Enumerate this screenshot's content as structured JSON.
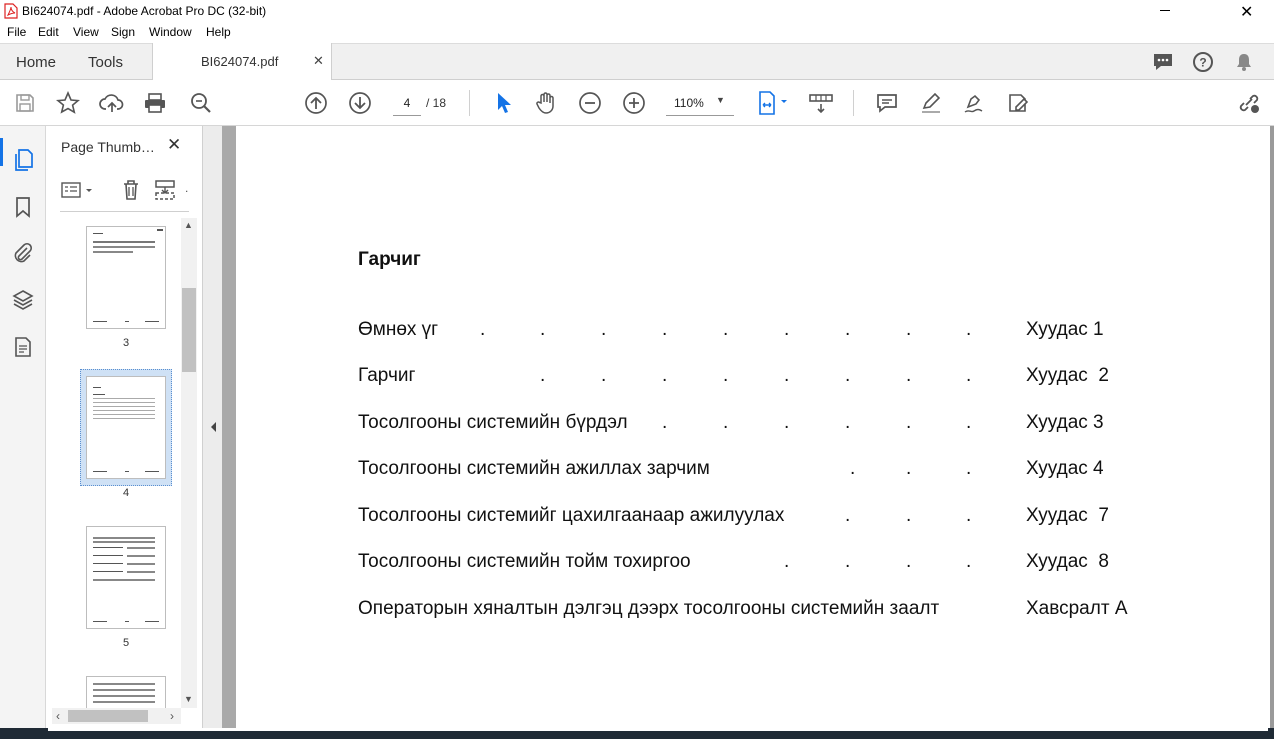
{
  "window": {
    "title": "BI624074.pdf - Adobe Acrobat Pro DC (32-bit)"
  },
  "menu": [
    "File",
    "Edit",
    "View",
    "Sign",
    "Window",
    "Help"
  ],
  "tabs": {
    "home": "Home",
    "tools": "Tools",
    "document": "BI624074.pdf"
  },
  "toolbar": {
    "current_page": "4",
    "page_total": "/ 18",
    "zoom": "110%"
  },
  "panel": {
    "title": "Page Thumb…"
  },
  "thumbnails": [
    {
      "label": "3"
    },
    {
      "label": "4"
    },
    {
      "label": "5"
    }
  ],
  "document": {
    "heading": "Гарчиг",
    "toc": [
      {
        "entry": "Өмнөх үг",
        "page": "Хуудас 1"
      },
      {
        "entry": "Гарчиг",
        "page": "Хуудас  2"
      },
      {
        "entry": "Тосолгооны системийн бүрдэл",
        "page": "Хуудас 3"
      },
      {
        "entry": "Тосолгооны системийн ажиллах зарчим",
        "page": "Хуудас 4"
      },
      {
        "entry": "Тосолгооны системийг цахилгаанаар ажилуулах",
        "page": "Хуудас  7"
      },
      {
        "entry": "Тосолгооны системийн тойм тохиргоо",
        "page": "Хуудас  8"
      },
      {
        "entry": "Операторын хяналтын дэлгэц дээрх тосолгооны системийн заалт",
        "page": "Хавсралт А"
      }
    ]
  },
  "colors": {
    "accent": "#1473e6",
    "selected_thumb_bg": "#cfe1f5"
  }
}
